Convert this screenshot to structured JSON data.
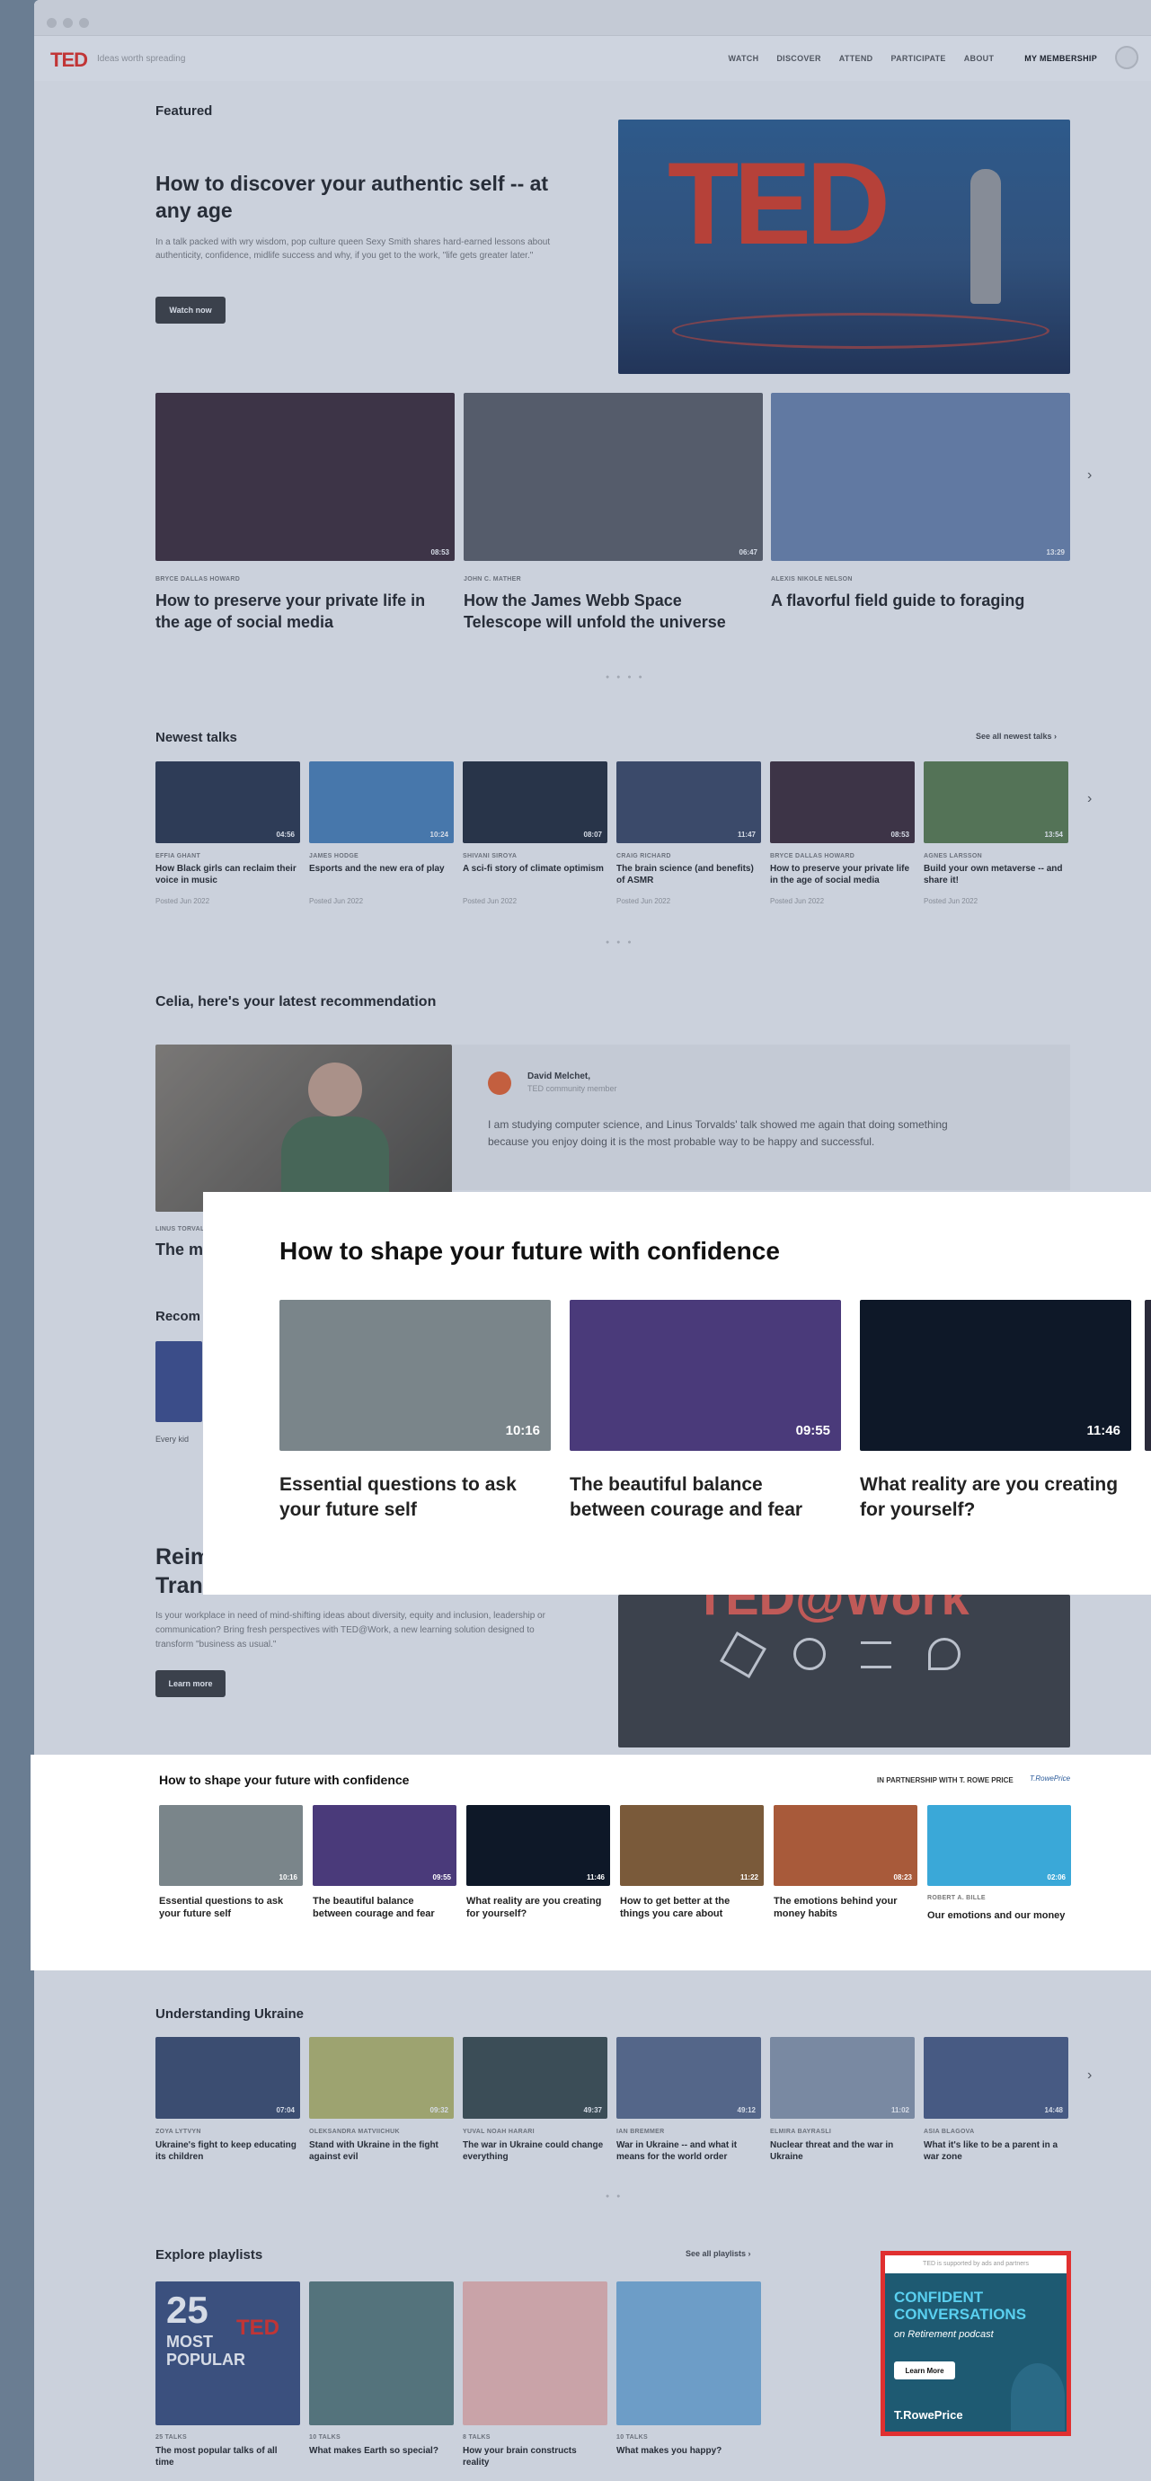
{
  "nav": {
    "logo": "TED",
    "tagline": "Ideas worth spreading",
    "links": [
      "WATCH",
      "DISCOVER",
      "ATTEND",
      "PARTICIPATE",
      "ABOUT",
      "MY MEMBERSHIP"
    ]
  },
  "featured": {
    "heading": "Featured",
    "title": "How to discover your authentic self -- at any age",
    "desc": "In a talk packed with wry wisdom, pop culture queen Sexy Smith shares hard-earned lessons about authenticity, confidence, midlife success and why, if you get to the work, \"life gets greater later.\"",
    "cta": "Watch now",
    "hero_text": "TED"
  },
  "featured_row": [
    {
      "speaker": "BRYCE DALLAS HOWARD",
      "title": "How to preserve your private life in the age of social media",
      "dur": "08:53",
      "bg": "#3d2a34"
    },
    {
      "speaker": "JOHN C. MATHER",
      "title": "How the James Webb Space Telescope will unfold the universe",
      "dur": "06:47",
      "bg": "#5b5d62"
    },
    {
      "speaker": "ALEXIS NIKOLE NELSON",
      "title": "A flavorful field guide to foraging",
      "dur": "13:29",
      "bg": "#6b82a8"
    }
  ],
  "newest": {
    "heading": "Newest talks",
    "see_all": "See all newest talks",
    "items": [
      {
        "speaker": "EFFIA GHANT",
        "title": "How Black girls can reclaim their voice in music",
        "posted": "Posted Jun 2022",
        "dur": "04:56",
        "bg": "#2a3448"
      },
      {
        "speaker": "JAMES HODGE",
        "title": "Esports and the new era of play",
        "posted": "Posted Jun 2022",
        "dur": "10:24",
        "bg": "#4a7fb4"
      },
      {
        "speaker": "SHIVANI SIROYA",
        "title": "A sci-fi story of climate optimism",
        "posted": "Posted Jun 2022",
        "dur": "08:07",
        "bg": "#222a36"
      },
      {
        "speaker": "CRAIG RICHARD",
        "title": "The brain science (and benefits) of ASMR",
        "posted": "Posted Jun 2022",
        "dur": "11:47",
        "bg": "#3a4660"
      },
      {
        "speaker": "BRYCE DALLAS HOWARD",
        "title": "How to preserve your private life in the age of social media",
        "posted": "Posted Jun 2022",
        "dur": "08:53",
        "bg": "#3d2a34"
      },
      {
        "speaker": "AGNES LARSSON",
        "title": "Build your own metaverse -- and share it!",
        "posted": "Posted Jun 2022",
        "dur": "13:54",
        "bg": "#5a7a48"
      }
    ]
  },
  "recommend": {
    "heading": "Celia, here's your latest recommendation",
    "user": "David Melchet,",
    "role": "TED community member",
    "quote": "I am studying computer science, and Linus Torvalds' talk showed me again that doing something because you enjoy doing it is the most probable way to be happy and successful.",
    "hidden_title": "The m",
    "hidden_speaker": "LINUS TORVALDS",
    "hidden_recom": "Recom",
    "hidden_every": "Every kid"
  },
  "zoom": {
    "title": "How to shape your future with confidence",
    "items": [
      {
        "title": "Essential questions to ask your future self",
        "dur": "10:16",
        "bg": "#7a858a"
      },
      {
        "title": "The beautiful balance between courage and fear",
        "dur": "09:55",
        "bg": "#4a3a7a"
      },
      {
        "title": "What reality are you creating for yourself?",
        "dur": "11:46",
        "bg": "#0e1828"
      }
    ]
  },
  "work": {
    "title_a": "Reim",
    "title_b": "Trans",
    "desc": "Is your workplace in need of mind-shifting ideas about diversity, equity and inclusion, leadership or communication? Bring fresh perspectives with TED@Work, a new learning solution designed to transform \"business as usual.\"",
    "cta": "Learn more",
    "logo": "TED@Work"
  },
  "strip": {
    "title": "How to shape your future with confidence",
    "partner": "IN PARTNERSHIP WITH T. ROWE PRICE",
    "partner_logo": "T.RowePrice",
    "items": [
      {
        "title": "Essential questions to ask your future self",
        "dur": "10:16",
        "bg": "#7a858a",
        "speaker": ""
      },
      {
        "title": "The beautiful balance between courage and fear",
        "dur": "09:55",
        "bg": "#4a3a7a",
        "speaker": ""
      },
      {
        "title": "What reality are you creating for yourself?",
        "dur": "11:46",
        "bg": "#0e1828",
        "speaker": ""
      },
      {
        "title": "How to get better at the things you care about",
        "dur": "11:22",
        "bg": "#7a5a3a",
        "speaker": ""
      },
      {
        "title": "The emotions behind your money habits",
        "dur": "08:23",
        "bg": "#a85a3a",
        "speaker": ""
      },
      {
        "title": "Our emotions and our money",
        "dur": "02:06",
        "bg": "#3aa8d8",
        "speaker": "ROBERT A. BILLE"
      }
    ]
  },
  "ukraine": {
    "heading": "Understanding Ukraine",
    "items": [
      {
        "speaker": "ZOYA LYTVYN",
        "title": "Ukraine's fight to keep educating its children",
        "dur": "07:04",
        "bg": "#3a4a6a"
      },
      {
        "speaker": "OLEKSANDRA MATVIICHUK",
        "title": "Stand with Ukraine in the fight against evil",
        "dur": "09:32",
        "bg": "#b8b868"
      },
      {
        "speaker": "YUVAL NOAH HARARI",
        "title": "The war in Ukraine could change everything",
        "dur": "49:37",
        "bg": "#3a4a48"
      },
      {
        "speaker": "IAN BREMMER",
        "title": "War in Ukraine -- and what it means for the world order",
        "dur": "49:12",
        "bg": "#5a6a88"
      },
      {
        "speaker": "ELMIRA BAYRASLI",
        "title": "Nuclear threat and the war in Ukraine",
        "dur": "11:02",
        "bg": "#8a96a8"
      },
      {
        "speaker": "ASIA BLAGOVA",
        "title": "What it's like to be a parent in a war zone",
        "dur": "14:48",
        "bg": "#4a5a80"
      }
    ]
  },
  "playlists": {
    "heading": "Explore playlists",
    "see_all": "See all playlists",
    "items": [
      {
        "count": "25 TALKS",
        "title": "The most popular talks of all time",
        "bg": "#3a4e7a"
      },
      {
        "count": "10 TALKS",
        "title": "What makes Earth so special?",
        "bg": "#5a7a78"
      },
      {
        "count": "8 TALKS",
        "title": "How your brain constructs reality",
        "bg": "#f0b8b0"
      },
      {
        "count": "10 TALKS",
        "title": "What makes you happy?",
        "bg": "#7ab0d8"
      }
    ],
    "poster_big": "25",
    "poster_small": "MOST POPULAR",
    "poster_logo": "TED"
  },
  "ad": {
    "note": "TED is supported by ads and partners",
    "headline": "CONFIDENT CONVERSATIONS",
    "sub": "on Retirement podcast",
    "cta": "Learn More",
    "brand": "T.RowePrice"
  }
}
